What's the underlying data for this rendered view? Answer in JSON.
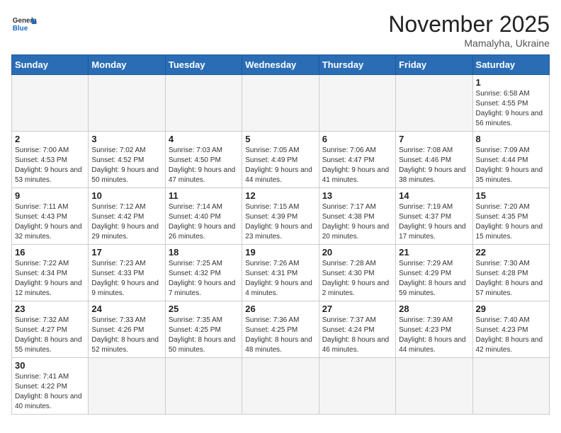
{
  "header": {
    "logo_general": "General",
    "logo_blue": "Blue",
    "month_year": "November 2025",
    "location": "Mamalyha, Ukraine"
  },
  "weekdays": [
    "Sunday",
    "Monday",
    "Tuesday",
    "Wednesday",
    "Thursday",
    "Friday",
    "Saturday"
  ],
  "weeks": [
    [
      {
        "day": "",
        "info": ""
      },
      {
        "day": "",
        "info": ""
      },
      {
        "day": "",
        "info": ""
      },
      {
        "day": "",
        "info": ""
      },
      {
        "day": "",
        "info": ""
      },
      {
        "day": "",
        "info": ""
      },
      {
        "day": "1",
        "info": "Sunrise: 6:58 AM\nSunset: 4:55 PM\nDaylight: 9 hours and 56 minutes."
      }
    ],
    [
      {
        "day": "2",
        "info": "Sunrise: 7:00 AM\nSunset: 4:53 PM\nDaylight: 9 hours and 53 minutes."
      },
      {
        "day": "3",
        "info": "Sunrise: 7:02 AM\nSunset: 4:52 PM\nDaylight: 9 hours and 50 minutes."
      },
      {
        "day": "4",
        "info": "Sunrise: 7:03 AM\nSunset: 4:50 PM\nDaylight: 9 hours and 47 minutes."
      },
      {
        "day": "5",
        "info": "Sunrise: 7:05 AM\nSunset: 4:49 PM\nDaylight: 9 hours and 44 minutes."
      },
      {
        "day": "6",
        "info": "Sunrise: 7:06 AM\nSunset: 4:47 PM\nDaylight: 9 hours and 41 minutes."
      },
      {
        "day": "7",
        "info": "Sunrise: 7:08 AM\nSunset: 4:46 PM\nDaylight: 9 hours and 38 minutes."
      },
      {
        "day": "8",
        "info": "Sunrise: 7:09 AM\nSunset: 4:44 PM\nDaylight: 9 hours and 35 minutes."
      }
    ],
    [
      {
        "day": "9",
        "info": "Sunrise: 7:11 AM\nSunset: 4:43 PM\nDaylight: 9 hours and 32 minutes."
      },
      {
        "day": "10",
        "info": "Sunrise: 7:12 AM\nSunset: 4:42 PM\nDaylight: 9 hours and 29 minutes."
      },
      {
        "day": "11",
        "info": "Sunrise: 7:14 AM\nSunset: 4:40 PM\nDaylight: 9 hours and 26 minutes."
      },
      {
        "day": "12",
        "info": "Sunrise: 7:15 AM\nSunset: 4:39 PM\nDaylight: 9 hours and 23 minutes."
      },
      {
        "day": "13",
        "info": "Sunrise: 7:17 AM\nSunset: 4:38 PM\nDaylight: 9 hours and 20 minutes."
      },
      {
        "day": "14",
        "info": "Sunrise: 7:19 AM\nSunset: 4:37 PM\nDaylight: 9 hours and 17 minutes."
      },
      {
        "day": "15",
        "info": "Sunrise: 7:20 AM\nSunset: 4:35 PM\nDaylight: 9 hours and 15 minutes."
      }
    ],
    [
      {
        "day": "16",
        "info": "Sunrise: 7:22 AM\nSunset: 4:34 PM\nDaylight: 9 hours and 12 minutes."
      },
      {
        "day": "17",
        "info": "Sunrise: 7:23 AM\nSunset: 4:33 PM\nDaylight: 9 hours and 9 minutes."
      },
      {
        "day": "18",
        "info": "Sunrise: 7:25 AM\nSunset: 4:32 PM\nDaylight: 9 hours and 7 minutes."
      },
      {
        "day": "19",
        "info": "Sunrise: 7:26 AM\nSunset: 4:31 PM\nDaylight: 9 hours and 4 minutes."
      },
      {
        "day": "20",
        "info": "Sunrise: 7:28 AM\nSunset: 4:30 PM\nDaylight: 9 hours and 2 minutes."
      },
      {
        "day": "21",
        "info": "Sunrise: 7:29 AM\nSunset: 4:29 PM\nDaylight: 8 hours and 59 minutes."
      },
      {
        "day": "22",
        "info": "Sunrise: 7:30 AM\nSunset: 4:28 PM\nDaylight: 8 hours and 57 minutes."
      }
    ],
    [
      {
        "day": "23",
        "info": "Sunrise: 7:32 AM\nSunset: 4:27 PM\nDaylight: 8 hours and 55 minutes."
      },
      {
        "day": "24",
        "info": "Sunrise: 7:33 AM\nSunset: 4:26 PM\nDaylight: 8 hours and 52 minutes."
      },
      {
        "day": "25",
        "info": "Sunrise: 7:35 AM\nSunset: 4:25 PM\nDaylight: 8 hours and 50 minutes."
      },
      {
        "day": "26",
        "info": "Sunrise: 7:36 AM\nSunset: 4:25 PM\nDaylight: 8 hours and 48 minutes."
      },
      {
        "day": "27",
        "info": "Sunrise: 7:37 AM\nSunset: 4:24 PM\nDaylight: 8 hours and 46 minutes."
      },
      {
        "day": "28",
        "info": "Sunrise: 7:39 AM\nSunset: 4:23 PM\nDaylight: 8 hours and 44 minutes."
      },
      {
        "day": "29",
        "info": "Sunrise: 7:40 AM\nSunset: 4:23 PM\nDaylight: 8 hours and 42 minutes."
      }
    ],
    [
      {
        "day": "30",
        "info": "Sunrise: 7:41 AM\nSunset: 4:22 PM\nDaylight: 8 hours and 40 minutes."
      },
      {
        "day": "",
        "info": ""
      },
      {
        "day": "",
        "info": ""
      },
      {
        "day": "",
        "info": ""
      },
      {
        "day": "",
        "info": ""
      },
      {
        "day": "",
        "info": ""
      },
      {
        "day": "",
        "info": ""
      }
    ]
  ]
}
